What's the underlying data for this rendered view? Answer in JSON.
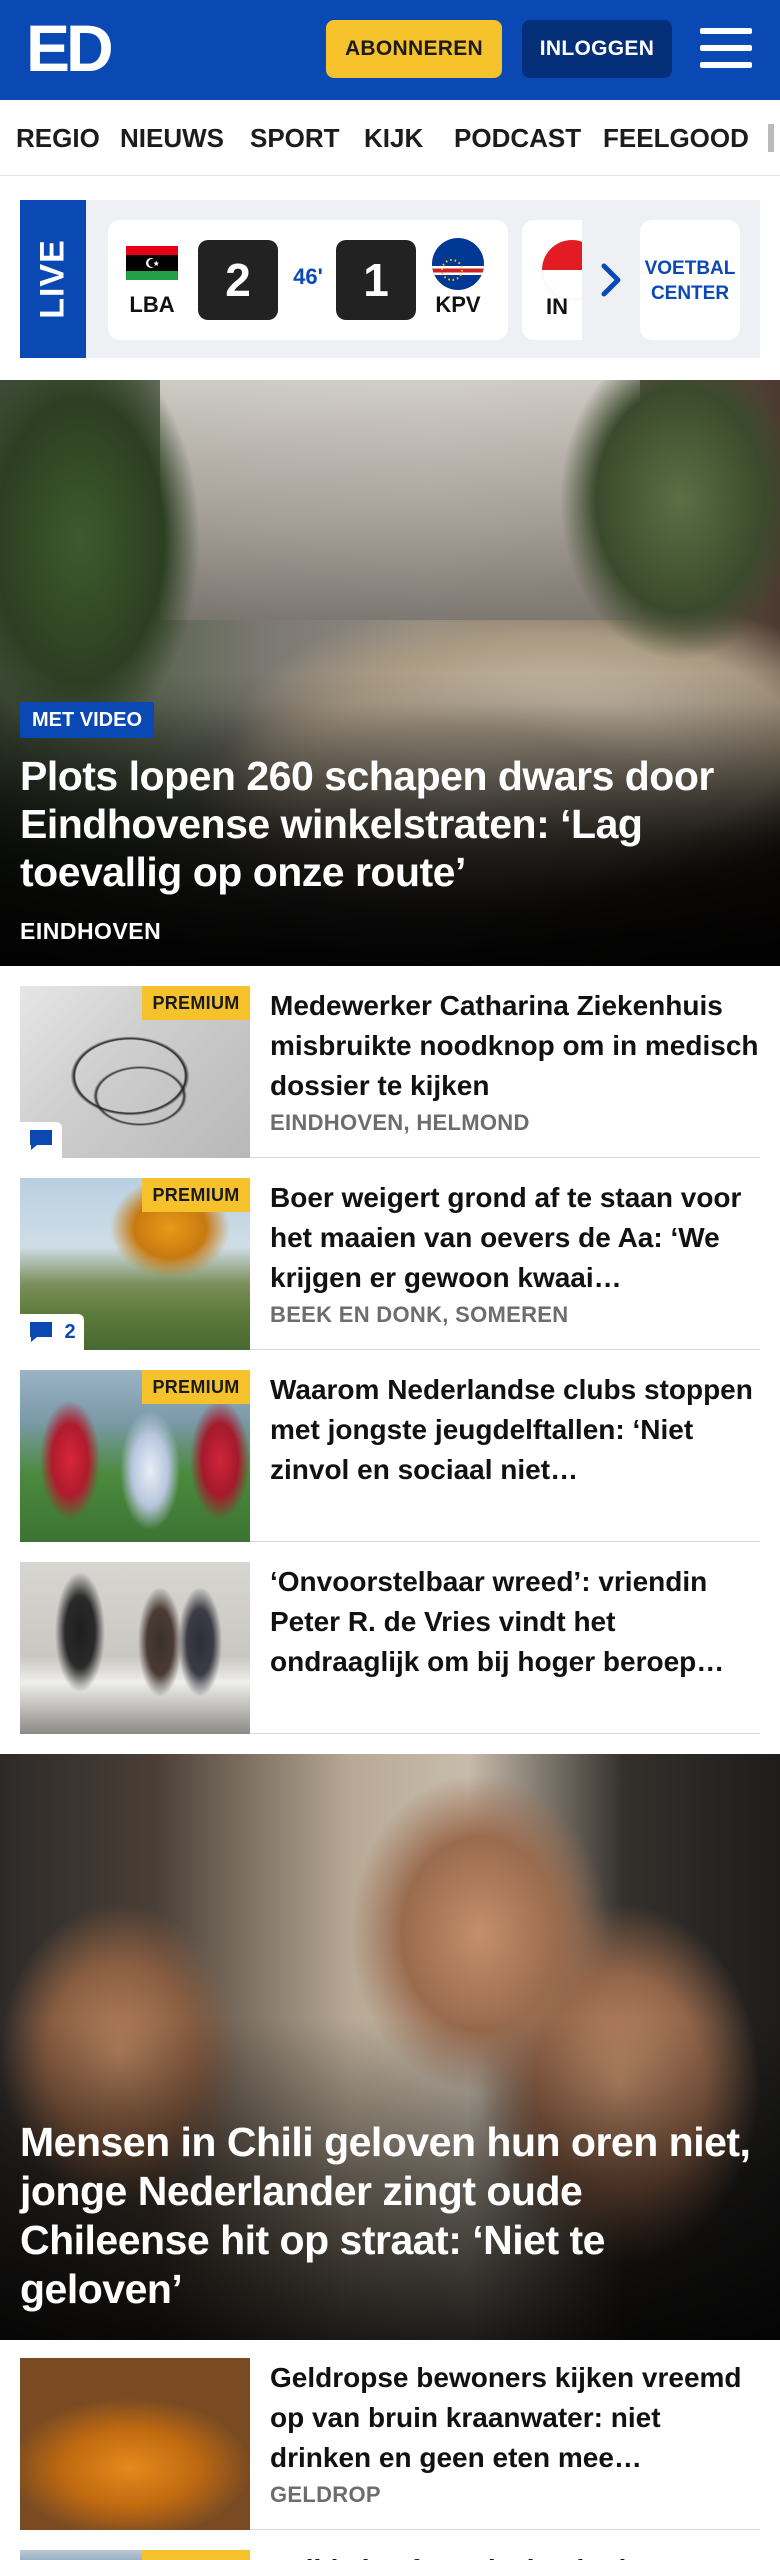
{
  "header": {
    "logo": "ED",
    "subscribe_label": "ABONNEREN",
    "login_label": "INLOGGEN"
  },
  "nav": {
    "items": [
      "REGIO",
      "NIEUWS",
      "SPORT",
      "KIJK",
      "PODCAST",
      "FEELGOOD"
    ]
  },
  "live": {
    "label": "LIVE",
    "match": {
      "home_code": "LBA",
      "home_score": "2",
      "minute": "46'",
      "away_score": "1",
      "away_code": "KPV"
    },
    "next_match_partial": "IN",
    "voetbal_center": "VOETBAL CENTER"
  },
  "hero": {
    "tag": "MET VIDEO",
    "title": "Plots lopen 260 schapen dwars door Eindhovense winkelstraten: ‘Lag toevallig op onze route’",
    "location": "EINDHOVEN"
  },
  "articles": [
    {
      "premium": "PREMIUM",
      "title": "Medewerker Catharina Ziekenhuis misbruikte noodknop om in medisch dossier te kijken",
      "location": "EINDHOVEN, HELMOND",
      "comments": ""
    },
    {
      "premium": "PREMIUM",
      "title": "Boer weigert grond af te staan voor het maaien van oevers de Aa: ‘We krijgen er gewoon kwaai…",
      "location": "BEEK EN DONK, SOMEREN",
      "comments": "2"
    },
    {
      "premium": "PREMIUM",
      "title": "Waarom Nederlandse clubs stoppen met jongste jeugdelftal­len: ‘Niet zinvol en sociaal niet…",
      "location": ""
    },
    {
      "premium": "",
      "title": "‘Onvoorstelbaar wreed’: vriendin Peter R. de Vries vindt het ondraaglijk om bij hoger beroep…",
      "location": ""
    }
  ],
  "hero2": {
    "title": "Mensen in Chili geloven hun oren niet, jonge Nederlander zingt oude Chileense hit op straat: ‘Niet te geloven’"
  },
  "article5": {
    "title": "Geldropse bewoners kijken vreemd op van bruin kraanwater: niet drinken en geen eten mee…",
    "location": "GELDROP"
  },
  "article6": {
    "premium": "PREMIUM",
    "title": "Politie heeft verdachte in de…"
  },
  "colors": {
    "brand_blue": "#0a48b4",
    "premium_yellow": "#f5c22b",
    "login_navy": "#062f7a"
  }
}
